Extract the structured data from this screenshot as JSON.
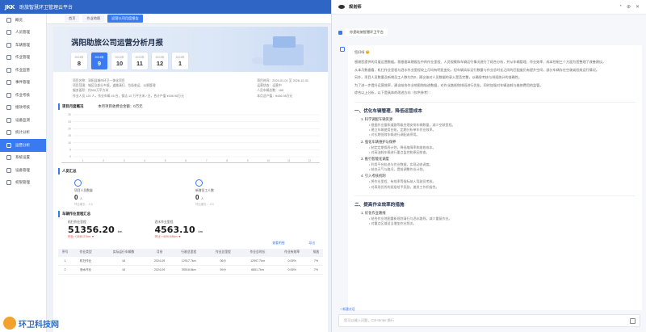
{
  "topbar": {
    "logo": "JKK",
    "title": "助旅智慧环卫管理云平台"
  },
  "sidebar": {
    "items": [
      {
        "label": "概览"
      },
      {
        "label": "人员管理"
      },
      {
        "label": "车辆管理"
      },
      {
        "label": "作业管理"
      },
      {
        "label": "作业监管"
      },
      {
        "label": "事件管理"
      },
      {
        "label": "作业考核"
      },
      {
        "label": "绩效考核"
      },
      {
        "label": "设备监测"
      },
      {
        "label": "统计分析"
      },
      {
        "label": "运营分析"
      },
      {
        "label": "系统设置"
      },
      {
        "label": "设备管理"
      },
      {
        "label": "权限管理"
      }
    ],
    "active_index": 10
  },
  "tabs": [
    {
      "label": "首页"
    },
    {
      "label": "作业地图"
    },
    {
      "label": "运营公司月度报告"
    }
  ],
  "report": {
    "title": "涡阳助旅公司运营分析月报",
    "months": [
      {
        "year": "2024年",
        "month": "8"
      },
      {
        "year": "2024年",
        "month": "9"
      },
      {
        "year": "2024年",
        "month": "10"
      },
      {
        "year": "2024年",
        "month": "11"
      },
      {
        "year": "2024年",
        "month": "12"
      },
      {
        "year": "2024年",
        "month": "1"
      }
    ],
    "info_left": [
      "项目名称：涡阳县城市环卫一体化项目",
      "项目范围：城区及部分乡镇，道路清扫、垃圾收运、公厕管理",
      "服务面积：约500万平方米",
      "作业人员 120 人，作业车辆 45 台，保洁 12 万平方米 / 日，合计产值 ¥436.98万元"
    ],
    "info_right": [
      "项目时间：2024-01-01 至 2026-12-31",
      "运营状态：运营中",
      "人员车辆总数：165",
      "本月总产值：¥436.98万元"
    ],
    "chart_section": {
      "title": "项目月度概况",
      "subtitle": "本月项目收费总金额：0万元"
    },
    "staff_section": {
      "title": "人员汇总"
    },
    "staff_kpis": [
      {
        "label": "项目人员数量",
        "value": "0",
        "unit": "人",
        "sub": "环比增长：-0.0"
      },
      {
        "label": "新增员工人数",
        "value": "0",
        "unit": "人",
        "sub": "环比增长：-0.0"
      }
    ],
    "mileage_section": {
      "title": "车辆作业里程汇总"
    },
    "big_kpis": [
      {
        "label": "机扫作业里程",
        "value": "51356.20",
        "unit": "km",
        "delta": "环比 +1555.27km ▼"
      },
      {
        "label": "洒水作业里程",
        "value": "4563.10",
        "unit": "km",
        "delta": "环比 +4094.69km ▼"
      }
    ],
    "table_links": [
      "查看明细",
      "导出"
    ],
    "table": {
      "headers": [
        "序号",
        "作业类型",
        "实际运行车辆数",
        "月份",
        "行驶总里程",
        "作业总里程",
        "作业总时长",
        "作业有效率",
        "排放"
      ],
      "rows": [
        [
          "1",
          "机扫作业",
          "18",
          "2024-09",
          "12917.7km",
          "06小",
          "12997.7km",
          "0.05%",
          "7%"
        ],
        [
          "2",
          "洒水作业",
          "16",
          "2024-09",
          "39518.8km",
          "59小",
          "6651.7km",
          "0.06%",
          "7%"
        ]
      ]
    }
  },
  "chart_data": {
    "type": "bar",
    "categories": [
      "1",
      "2",
      "3",
      "4",
      "5",
      "6",
      "7",
      "8",
      "9",
      "10",
      "11",
      "12"
    ],
    "values": [
      0,
      0,
      0,
      0,
      0,
      0,
      0,
      0,
      0,
      0,
      0,
      0
    ],
    "yticks": [
      "0",
      "5",
      "10",
      "15",
      "20",
      "25",
      "30"
    ],
    "ylim": [
      0,
      30
    ]
  },
  "chat": {
    "title": "规划师",
    "user_message": "你是助旅智慧环卫平台",
    "greeting": "您好呀 😊",
    "paragraphs": [
      "感谢您提供的月度运营数据。我根据本期报告中的作业里程、人员规模和车辆运行情况进行了综合分析，并从车辆管理、作业效率、成本控制三个方面为您整理了改善建议。",
      "从本月数据看，机扫作业里程与洒水作业里程较上月均有明显变化，但车辆实际运行数量与作业总时长之间的匹配度仍有提升空间，部分车辆存在空驶或低效运行情况。",
      "另外，项目人员数量及新增员工人数均为0，建议核对人员数据的录入是否完整，以确保考核与排班统计的准确性。",
      "为了进一步提升运营效率，建议结合作业地图和轨迹数据，对作业路线和排班进行优化，同时加强对车辆油耗与维修费用的监管。",
      "综合以上分析，以下是具体的改进方向（仅供参考）："
    ],
    "sections": [
      {
        "title": "一、优化车辆管理，降低运营成本",
        "groups": [
          {
            "title": "1. 科学调配车辆资源",
            "items": [
              "根据作业量和道路等级合理安排车辆数量，减少空驶里程。",
              "建立车辆使用台账，定期分析单车作业效率。",
              "对长期低效车辆进行调配或停用。"
            ]
          },
          {
            "title": "2. 强化车辆维护与保养",
            "items": [
              "制定定期保养计划，降低故障率和维修成本。",
              "对高油耗车辆进行重点监控和原因排查。"
            ]
          },
          {
            "title": "3. 推行智能化调度",
            "items": [
              "利用平台轨迹与作业数据，实现动态调度。",
              "结合天气与路况，提前调整作业计划。"
            ]
          },
          {
            "title": "4. 引入考核机制",
            "items": [
              "将作业里程、有效率等指标纳入驾驶员考核。",
              "对表现优秀的班组给予奖励，激发工作积极性。"
            ]
          }
        ]
      },
      {
        "title": "二、提高作业效率的措施",
        "groups": [
          {
            "title": "1. 优化作业路线",
            "items": [
              "结合作业地图重新规划清扫与洒水路线，减少重复作业。",
              "对重点区域适当增加作业频次。"
            ]
          }
        ]
      }
    ],
    "quick_link": "+ 新建对话",
    "input_placeholder": "您可以输入问题，Ctrl+Enter 换行"
  },
  "watermark": {
    "text": "环卫科技网"
  }
}
